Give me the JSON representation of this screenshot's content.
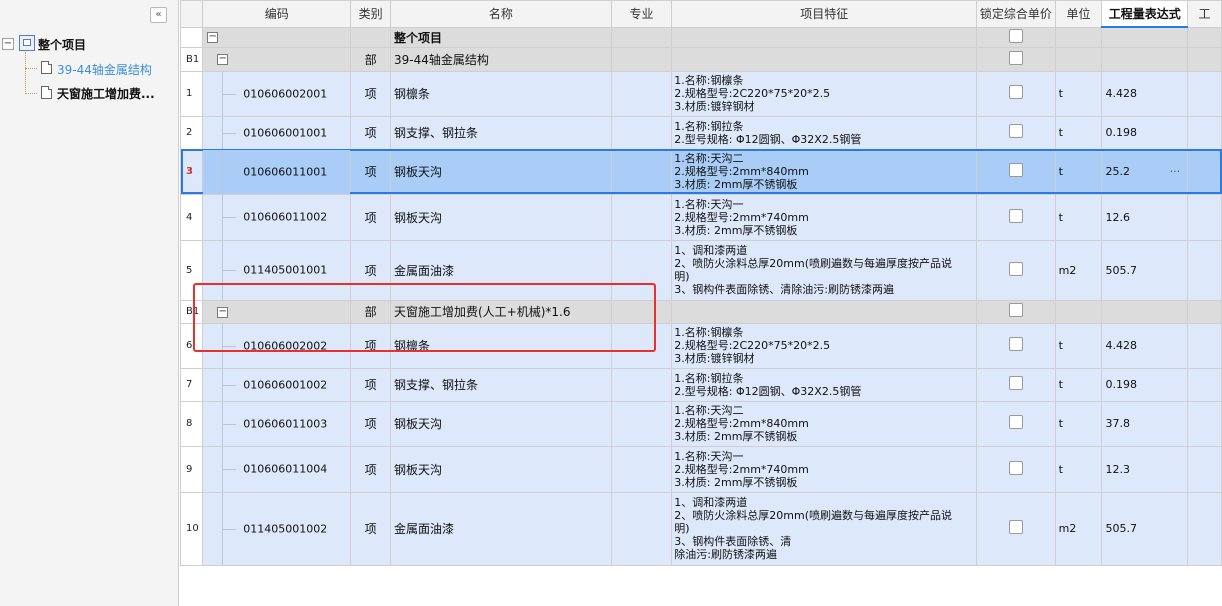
{
  "tree": {
    "root": "整个项目",
    "children": [
      "39-44轴金属结构",
      "天窗施工增加费..."
    ]
  },
  "grid": {
    "headers": [
      "编码",
      "类别",
      "名称",
      "专业",
      "项目特征",
      "锁定综合单价",
      "单位",
      "工程量表达式",
      "工"
    ],
    "rows": [
      {
        "num": "",
        "code": "",
        "type": "",
        "name": "整个项目",
        "feat": [],
        "unit": "",
        "qty": ""
      },
      {
        "num": "B1",
        "code": "",
        "type": "部",
        "name": "39-44轴金属结构",
        "feat": [],
        "unit": "",
        "qty": ""
      },
      {
        "num": "1",
        "code": "010606002001",
        "type": "项",
        "name": "钢檩条",
        "feat": [
          "1.名称:钢檩条",
          "2.规格型号:2C220*75*20*2.5",
          "3.材质:镀锌钢材"
        ],
        "unit": "t",
        "qty": "4.428"
      },
      {
        "num": "2",
        "code": "010606001001",
        "type": "项",
        "name": "钢支撑、钢拉条",
        "feat": [
          "1.名称:钢拉条",
          "2.型号规格: Φ12圆钢、Φ32X2.5钢管"
        ],
        "unit": "t",
        "qty": "0.198"
      },
      {
        "num": "3",
        "code": "010606011001",
        "type": "项",
        "name": "钢板天沟",
        "feat": [
          "1.名称:天沟二",
          "2.规格型号:2mm*840mm",
          "3.材质: 2mm厚不锈钢板"
        ],
        "unit": "t",
        "qty": "25.2",
        "more": "···"
      },
      {
        "num": "4",
        "code": "010606011002",
        "type": "项",
        "name": "钢板天沟",
        "feat": [
          "1.名称:天沟一",
          "2.规格型号:2mm*740mm",
          "3.材质: 2mm厚不锈钢板"
        ],
        "unit": "t",
        "qty": "12.6"
      },
      {
        "num": "5",
        "code": "011405001001",
        "type": "项",
        "name": "金属面油漆",
        "feat": [
          "1、调和漆两道",
          "2、喷防火涂料总厚20mm(喷刷遍数与每遍厚度按产品说",
          "明)",
          "3、钢构件表面除锈、清除油污:刷防锈漆两遍"
        ],
        "unit": "m2",
        "qty": "505.7"
      },
      {
        "num": "B1",
        "code": "",
        "type": "部",
        "name": "天窗施工增加费(人工+机械)*1.6",
        "feat": [],
        "unit": "",
        "qty": ""
      },
      {
        "num": "6",
        "code": "010606002002",
        "type": "项",
        "name": "钢檩条",
        "feat": [
          "1.名称:钢檩条",
          "2.规格型号:2C220*75*20*2.5",
          "3.材质:镀锌钢材"
        ],
        "unit": "t",
        "qty": "4.428"
      },
      {
        "num": "7",
        "code": "010606001002",
        "type": "项",
        "name": "钢支撑、钢拉条",
        "feat": [
          "1.名称:钢拉条",
          "2.型号规格: Φ12圆钢、Φ32X2.5钢管"
        ],
        "unit": "t",
        "qty": "0.198"
      },
      {
        "num": "8",
        "code": "010606011003",
        "type": "项",
        "name": "钢板天沟",
        "feat": [
          "1.名称:天沟二",
          "2.规格型号:2mm*840mm",
          "3.材质: 2mm厚不锈钢板"
        ],
        "unit": "t",
        "qty": "37.8"
      },
      {
        "num": "9",
        "code": "010606011004",
        "type": "项",
        "name": "钢板天沟",
        "feat": [
          "1.名称:天沟一",
          "2.规格型号:2mm*740mm",
          "3.材质: 2mm厚不锈钢板"
        ],
        "unit": "t",
        "qty": "12.3"
      },
      {
        "num": "10",
        "code": "011405001002",
        "type": "项",
        "name": "金属面油漆",
        "feat": [
          "1、调和漆两道",
          "2、喷防火涂料总厚20mm(喷刷遍数与每遍厚度按产品说",
          "明)",
          "3、钢构件表面除锈、清",
          "除油污:刷防锈漆两遍"
        ],
        "unit": "m2",
        "qty": "505.7"
      }
    ]
  },
  "icons": {
    "collapse": "«",
    "expand": "−"
  },
  "colors": {
    "accent": "#2a7ae2",
    "highlight": "#e8302c",
    "row_bg": "#dde9fb",
    "selected_bg": "#a9cdf6"
  }
}
